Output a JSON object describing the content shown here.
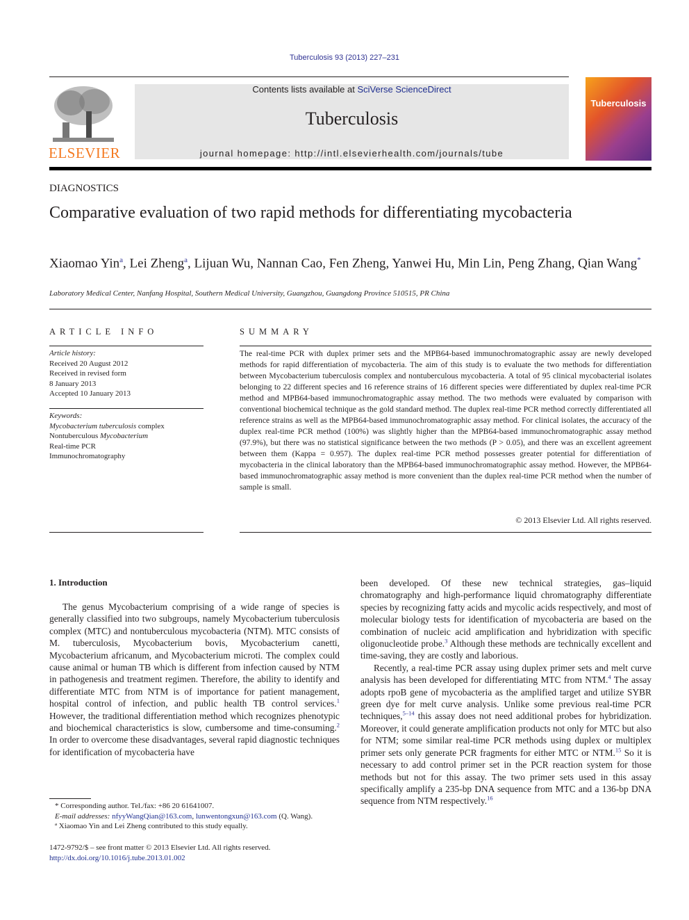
{
  "header": {
    "journal_ref": "Tuberculosis 93 (2013) 227–231",
    "contents_prefix": "Contents lists available at ",
    "contents_link": "SciVerse ScienceDirect",
    "journal_title": "Tuberculosis",
    "homepage": "journal homepage: http://intl.elsevierhealth.com/journals/tube",
    "publisher_logo": "ELSEVIER",
    "cover_title": "Tuberculosis"
  },
  "article": {
    "section": "DIAGNOSTICS",
    "title": "Comparative evaluation of two rapid methods for differentiating mycobacteria",
    "authors": [
      {
        "name": "Xiaomao Yin",
        "mark": "a",
        "sep": ", "
      },
      {
        "name": "Lei Zheng",
        "mark": "a",
        "sep": ", "
      },
      {
        "name": "Lijuan Wu",
        "mark": "",
        "sep": ", "
      },
      {
        "name": "Nannan Cao",
        "mark": "",
        "sep": ", "
      },
      {
        "name": "Fen Zheng",
        "mark": "",
        "sep": ", "
      },
      {
        "name": "Yanwei Hu",
        "mark": "",
        "sep": ", "
      },
      {
        "name": "Min Lin",
        "mark": "",
        "sep": ", "
      },
      {
        "name": "Peng Zhang",
        "mark": "",
        "sep": ", "
      },
      {
        "name": "Qian Wang",
        "mark": "*",
        "sep": ""
      }
    ],
    "affiliation": "Laboratory Medical Center, Nanfang Hospital, Southern Medical University, Guangzhou, Guangdong Province 510515, PR China"
  },
  "article_info": {
    "heading": "ARTICLE INFO",
    "history_label": "Article history:",
    "history": [
      "Received 20 August 2012",
      "Received in revised form",
      "8 January 2013",
      "Accepted 10 January 2013"
    ],
    "keywords_label": "Keywords:",
    "keywords": [
      "Mycobacterium tuberculosis complex",
      "Nontuberculous Mycobacterium",
      "Real-time PCR",
      "Immunochromatography"
    ]
  },
  "summary": {
    "heading": "SUMMARY",
    "text": "The real-time PCR with duplex primer sets and the MPB64-based immunochromatographic assay are newly developed methods for rapid differentiation of mycobacteria. The aim of this study is to evaluate the two methods for differentiation between Mycobacterium tuberculosis complex and nontuberculous mycobacteria. A total of 95 clinical mycobacterial isolates belonging to 22 different species and 16 reference strains of 16 different species were differentiated by duplex real-time PCR method and MPB64-based immunochromatographic assay method. The two methods were evaluated by comparison with conventional biochemical technique as the gold standard method. The duplex real-time PCR method correctly differentiated all reference strains as well as the MPB64-based immunochromatographic assay method. For clinical isolates, the accuracy of the duplex real-time PCR method (100%) was slightly higher than the MPB64-based immunochromatographic assay method (97.9%), but there was no statistical significance between the two methods (P > 0.05), and there was an excellent agreement between them (Kappa = 0.957). The duplex real-time PCR method possesses greater potential for differentiation of mycobacteria in the clinical laboratory than the MPB64-based immunochromatographic assay method. However, the MPB64-based immunochromatographic assay method is more convenient than the duplex real-time PCR method when the number of sample is small.",
    "copyright": "© 2013 Elsevier Ltd. All rights reserved."
  },
  "body": {
    "intro_heading": "1.  Introduction",
    "left_paragraph": "The genus Mycobacterium comprising of a wide range of species is generally classified into two subgroups, namely Mycobacterium tuberculosis complex (MTC) and nontuberculous mycobacteria (NTM). MTC consists of M. tuberculosis, Mycobacterium bovis, Mycobacterium canetti, Mycobacterium africanum, and Mycobacterium microti. The complex could cause animal or human TB which is different from infection caused by NTM in pathogenesis and treatment regimen. Therefore, the ability to identify and differentiate MTC from NTM is of importance for patient management, hospital control of infection, and public health TB control services.[1] However, the traditional differentiation method which recognizes phenotypic and biochemical characteristics is slow, cumbersome and time-consuming.[2] In order to overcome these disadvantages, several rapid diagnostic techniques for identification of mycobacteria have",
    "right_continuation": "been developed. Of these new technical strategies, gas–liquid chromatography and high-performance liquid chromatography differentiate species by recognizing fatty acids and mycolic acids respectively, and most of molecular biology tests for identification of mycobacteria are based on the combination of nucleic acid amplification and hybridization with specific oligonucleotide probe.[3] Although these methods are technically excellent and time-saving, they are costly and laborious.",
    "right_paragraph": "Recently, a real-time PCR assay using duplex primer sets and melt curve analysis has been developed for differentiating MTC from NTM.[4] The assay adopts rpoB gene of mycobacteria as the amplified target and utilize SYBR green dye for melt curve analysis. Unlike some previous real-time PCR techniques,[5–14] this assay does not need additional probes for hybridization. Moreover, it could generate amplification products not only for MTC but also for NTM; some similar real-time PCR methods using duplex or multiplex primer sets only generate PCR fragments for either MTC or NTM.[15] So it is necessary to add control primer set in the PCR reaction system for those methods but not for this assay. The two primer sets used in this assay specifically amplify a 235-bp DNA sequence from MTC and a 136-bp DNA sequence from NTM respectively.[16]"
  },
  "footnotes": {
    "corresponding": "* Corresponding author. Tel./fax: +86 20 61641007.",
    "email_label": "E-mail addresses: ",
    "emails": [
      "nfyyWangQian@163.com",
      "lunwentongxun@163.com"
    ],
    "email_suffix": " (Q. Wang).",
    "equal": "ª Xiaomao Yin and Lei Zheng contributed to this study equally."
  },
  "front_matter": {
    "issn": "1472-9792/$ – see front matter © 2013 Elsevier Ltd. All rights reserved.",
    "doi": "http://dx.doi.org/10.1016/j.tube.2013.01.002"
  }
}
